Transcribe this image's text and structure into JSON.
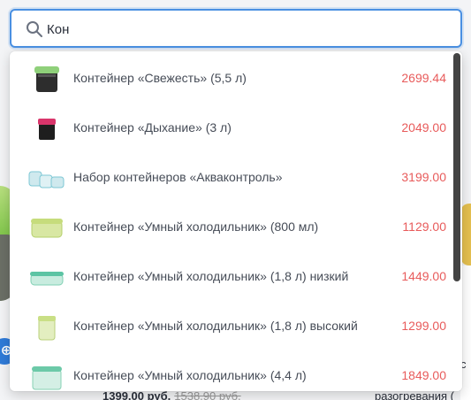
{
  "search": {
    "value": "Кон",
    "icon": "search-icon"
  },
  "results": [
    {
      "name": "Контейнер «Свежесть» (5,5 л)",
      "price": "2699.44"
    },
    {
      "name": "Контейнер «Дыхание» (3 л)",
      "price": "2049.00"
    },
    {
      "name": "Набор контейнеров «Акваконтроль»",
      "price": "3199.00"
    },
    {
      "name": "Контейнер «Умный холодильник» (800 мл)",
      "price": "1129.00"
    },
    {
      "name": "Контейнер «Умный холодильник» (1,8 л) низкий",
      "price": "1449.00"
    },
    {
      "name": "Контейнер «Умный холодильник» (1,8 л) высокий",
      "price": "1299.00"
    },
    {
      "name": "Контейнер «Умный холодильник» (4,4 л)",
      "price": "1849.00"
    }
  ],
  "background": {
    "price": "1399.00 руб.",
    "old_price": "1538.90 руб.",
    "right_text": "разогревания (",
    "right_letter": "с"
  },
  "colors": {
    "accent": "#4a90e2",
    "price": "#e85b5b"
  }
}
